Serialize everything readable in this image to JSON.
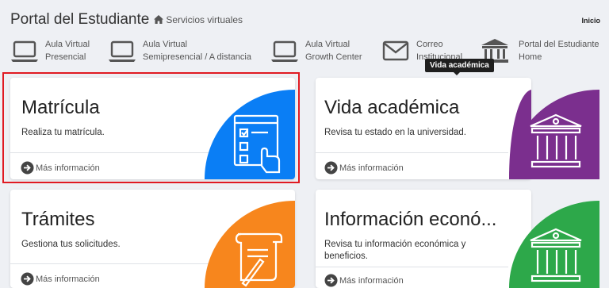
{
  "header": {
    "title": "Portal del Estudiante",
    "breadcrumb": "Servicios virtuales",
    "inicio": "Inicio"
  },
  "shortcuts": [
    {
      "icon": "laptop-icon",
      "line1": "Aula Virtual",
      "line2": "Presencial"
    },
    {
      "icon": "laptop-icon",
      "line1": "Aula Virtual",
      "line2": "Semipresencial / A distancia"
    },
    {
      "icon": "laptop-icon",
      "line1": "Aula Virtual",
      "line2": "Growth Center"
    },
    {
      "icon": "envelope-icon",
      "line1": "Correo",
      "line2": "Institucional"
    },
    {
      "icon": "institution-icon",
      "line1": "Portal del Estudiante",
      "line2": "Home"
    }
  ],
  "tooltip": "Vida académica",
  "cards": [
    {
      "title": "Matrícula",
      "desc": "Realiza tu matrícula.",
      "more": "Más información",
      "color": "#0a7ef5",
      "icon": "enrollment-form-icon",
      "selected": true
    },
    {
      "title": "Vida académica",
      "desc": "Revisa tu estado en la universidad.",
      "more": "Más información",
      "color": "#7b2f8e",
      "icon": "university-building-icon"
    },
    {
      "title": "Trámites",
      "desc": "Gestiona tus solicitudes.",
      "more": "Más información",
      "color": "#f7861d",
      "icon": "document-quill-icon"
    },
    {
      "title": "Información econó...",
      "desc": "Revisa tu información económica y beneficios.",
      "more": "Más información",
      "color": "#2da84a",
      "icon": "university-building-icon"
    }
  ],
  "colors": {
    "selection": "#e01a22",
    "background": "#eef0f4"
  }
}
